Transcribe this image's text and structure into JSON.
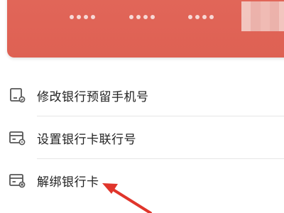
{
  "card": {
    "masked_groups": [
      "••••",
      "••••",
      "••••"
    ]
  },
  "menu": {
    "items": [
      {
        "label": "修改银行预留手机号",
        "icon": "phone-edit-icon"
      },
      {
        "label": "设置银行卡联行号",
        "icon": "card-setting-icon"
      },
      {
        "label": "解绑银行卡",
        "icon": "card-unbind-icon"
      }
    ]
  },
  "colors": {
    "card": "#e2675a",
    "text": "#222222",
    "icon": "#555555",
    "arrow": "#e0352b",
    "divider": "#e6e6e6"
  }
}
